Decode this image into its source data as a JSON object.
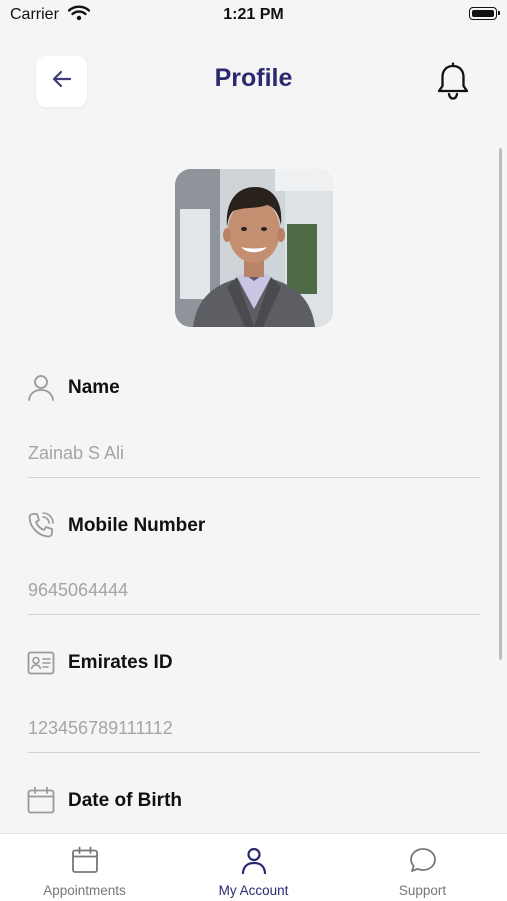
{
  "status_bar": {
    "carrier": "Carrier",
    "time": "1:21 PM"
  },
  "header": {
    "title": "Profile"
  },
  "fields": [
    {
      "label": "Name",
      "value": "Zainab S Ali"
    },
    {
      "label": "Mobile Number",
      "value": "9645064444"
    },
    {
      "label": "Emirates ID",
      "value": "123456789111112"
    },
    {
      "label": "Date of Birth",
      "value": ""
    }
  ],
  "tabs": [
    {
      "label": "Appointments",
      "icon": "calendar-icon",
      "active": false
    },
    {
      "label": "My Account",
      "icon": "user-icon",
      "active": true
    },
    {
      "label": "Support",
      "icon": "chat-bubble-icon",
      "active": false
    }
  ],
  "colors": {
    "accent": "#2a2a6e",
    "placeholder": "#a5a5a5",
    "background": "#f5f5f5"
  }
}
